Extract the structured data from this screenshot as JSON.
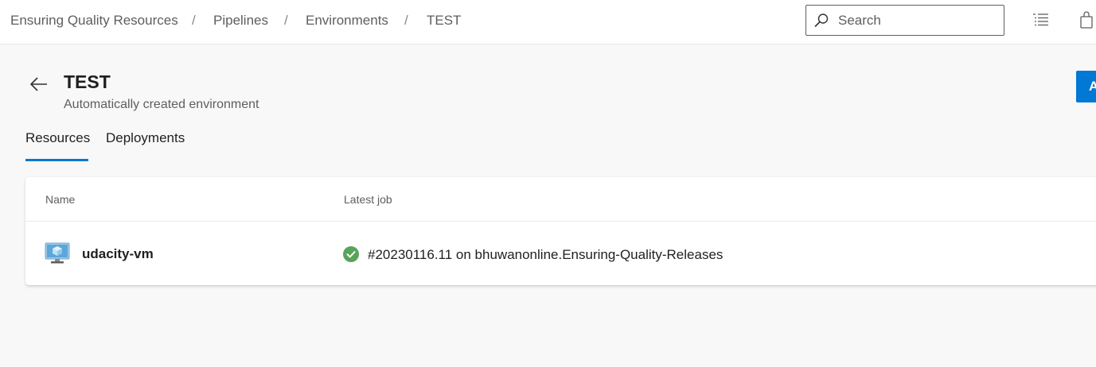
{
  "breadcrumb": {
    "items": [
      "Ensuring Quality Resources",
      "Pipelines",
      "Environments",
      "TEST"
    ],
    "separator": "/"
  },
  "search": {
    "placeholder": "Search"
  },
  "header": {
    "title": "TEST",
    "subtitle": "Automatically created environment",
    "primary_button_label": "A"
  },
  "tabs": [
    {
      "label": "Resources",
      "selected": true
    },
    {
      "label": "Deployments",
      "selected": false
    }
  ],
  "table": {
    "columns": [
      "Name",
      "Latest job"
    ],
    "rows": [
      {
        "name": "udacity-vm",
        "status": "succeeded",
        "latest_job": "#20230116.11 on bhuwanonline.Ensuring-Quality-Releases"
      }
    ]
  },
  "colors": {
    "accent": "#0078d4",
    "success": "#57a45b"
  }
}
